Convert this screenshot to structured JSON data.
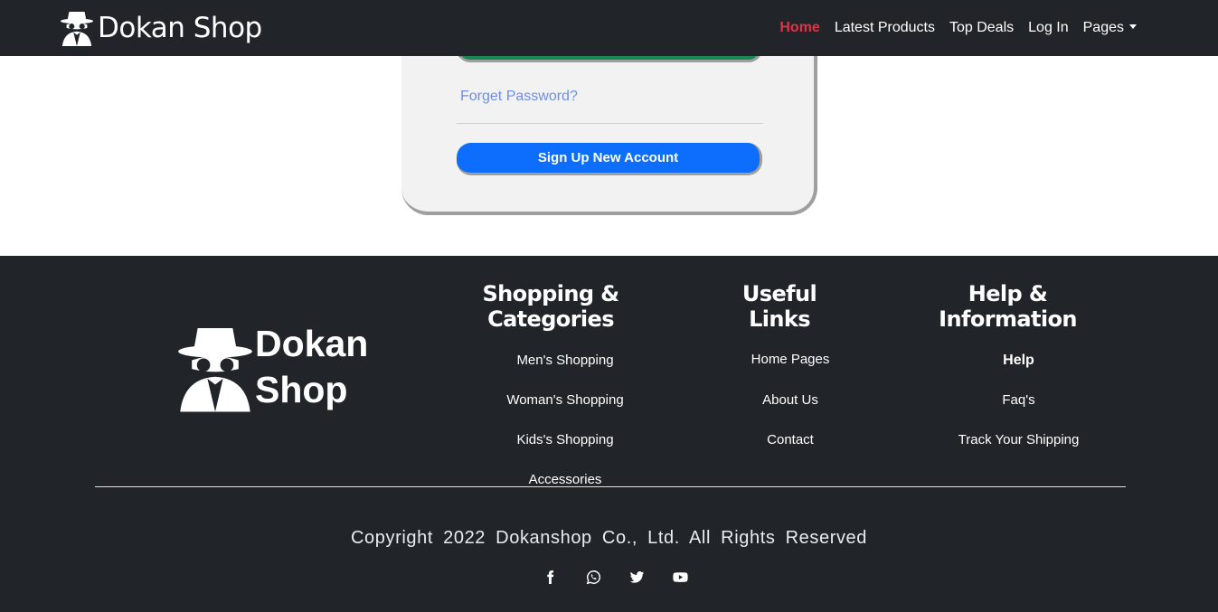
{
  "navbar": {
    "brand": "Dokan Shop",
    "links": [
      "Home",
      "Latest Products",
      "Top Deals",
      "Log In",
      "Pages"
    ]
  },
  "login_card": {
    "forget_password": "Forget Password?",
    "signup_button": "Sign Up New Account"
  },
  "footer": {
    "brand_line1": "Dokan",
    "brand_line2": "Shop",
    "shopping": {
      "heading": "Shopping & Categories",
      "items": [
        "Men's Shopping",
        "Woman's Shopping",
        "Kids's Shopping",
        "Accessories"
      ]
    },
    "useful": {
      "heading": "Useful Links",
      "items": [
        "Home Pages",
        "About Us",
        "Contact"
      ]
    },
    "help": {
      "heading": "Help & Information",
      "items": [
        "Help",
        "Faq's",
        "Track Your Shipping"
      ]
    },
    "copyright": "Copyright 2022 Dokanshop Co., Ltd. All Rights Reserved",
    "socials": [
      "facebook-icon",
      "whatsapp-icon",
      "twitter-icon",
      "youtube-icon"
    ]
  },
  "colors": {
    "navbar_bg": "#212529",
    "active_link": "#dc3545",
    "primary_button": "#0d6efd",
    "success_button": "#198754",
    "link": "#6f8ee6"
  }
}
